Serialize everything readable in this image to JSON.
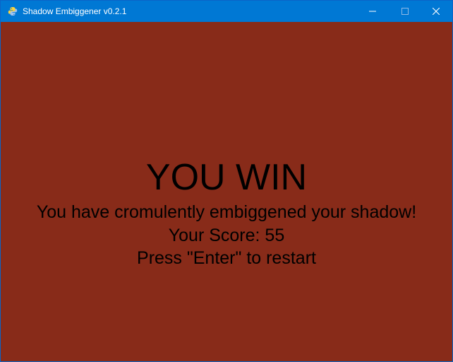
{
  "window": {
    "title": "Shadow Embiggener v0.2.1",
    "icons": {
      "app": "python-icon",
      "minimize": "minimize-icon",
      "maximize": "maximize-icon",
      "close": "close-icon"
    },
    "colors": {
      "titlebar": "#0078d4",
      "titlebar_text": "#ffffff"
    }
  },
  "game": {
    "background_color": "#882b19",
    "text_color": "#000000",
    "headline": "YOU WIN",
    "message": "You have cromulently embiggened your shadow!",
    "score_line": "Your Score: 55",
    "restart_prompt": "Press \"Enter\" to restart"
  }
}
